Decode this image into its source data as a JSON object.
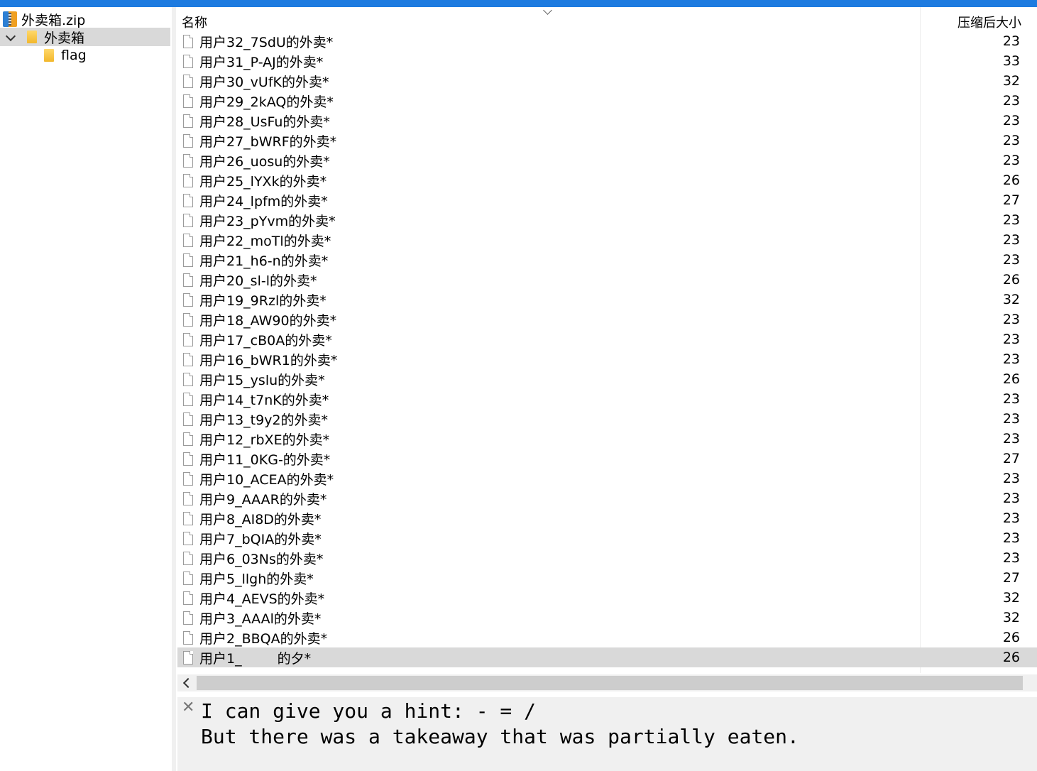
{
  "tree": {
    "archive_label": "外卖箱.zip",
    "folder_label": "外卖箱",
    "subfolder_label": "flag"
  },
  "list": {
    "header_name": "名称",
    "header_size": "压缩后大小",
    "rows": [
      {
        "name": "用户32_7SdU的外卖*",
        "size": "23"
      },
      {
        "name": "用户31_P-AJ的外卖*",
        "size": "33"
      },
      {
        "name": "用户30_vUfK的外卖*",
        "size": "32"
      },
      {
        "name": "用户29_2kAQ的外卖*",
        "size": "23"
      },
      {
        "name": "用户28_UsFu的外卖*",
        "size": "23"
      },
      {
        "name": "用户27_bWRF的外卖*",
        "size": "23"
      },
      {
        "name": "用户26_uosu的外卖*",
        "size": "23"
      },
      {
        "name": "用户25_lYXk的外卖*",
        "size": "26"
      },
      {
        "name": "用户24_lpfm的外卖*",
        "size": "27"
      },
      {
        "name": "用户23_pYvm的外卖*",
        "size": "23"
      },
      {
        "name": "用户22_moTl的外卖*",
        "size": "23"
      },
      {
        "name": "用户21_h6-n的外卖*",
        "size": "23"
      },
      {
        "name": "用户20_sl-l的外卖*",
        "size": "26"
      },
      {
        "name": "用户19_9Rzl的外卖*",
        "size": "32"
      },
      {
        "name": "用户18_AW90的外卖*",
        "size": "23"
      },
      {
        "name": "用户17_cB0A的外卖*",
        "size": "23"
      },
      {
        "name": "用户16_bWR1的外卖*",
        "size": "23"
      },
      {
        "name": "用户15_yslu的外卖*",
        "size": "26"
      },
      {
        "name": "用户14_t7nK的外卖*",
        "size": "23"
      },
      {
        "name": "用户13_t9y2的外卖*",
        "size": "23"
      },
      {
        "name": "用户12_rbXE的外卖*",
        "size": "23"
      },
      {
        "name": "用户11_0KG-的外卖*",
        "size": "27"
      },
      {
        "name": "用户10_ACEA的外卖*",
        "size": "23"
      },
      {
        "name": "用户9_AAAR的外卖*",
        "size": "23"
      },
      {
        "name": "用户8_AI8D的外卖*",
        "size": "23"
      },
      {
        "name": "用户7_bQIA的外卖*",
        "size": "23"
      },
      {
        "name": "用户6_03Ns的外卖*",
        "size": "23"
      },
      {
        "name": "用户5_llgh的外卖*",
        "size": "27"
      },
      {
        "name": "用户4_AEVS的外卖*",
        "size": "32"
      },
      {
        "name": "用户3_AAAl的外卖*",
        "size": "32"
      },
      {
        "name": "用户2_BBQA的外卖*",
        "size": "26"
      }
    ],
    "last_row": {
      "name_a": "用户1_",
      "name_b": "的夕*",
      "size": "26"
    }
  },
  "hint": {
    "line1": "I can give you a hint: - = /",
    "line2": "But there was a takeaway that was partially eaten."
  },
  "colors": {
    "title_bar": "#1e7be0",
    "selection": "#d9d9d9"
  }
}
